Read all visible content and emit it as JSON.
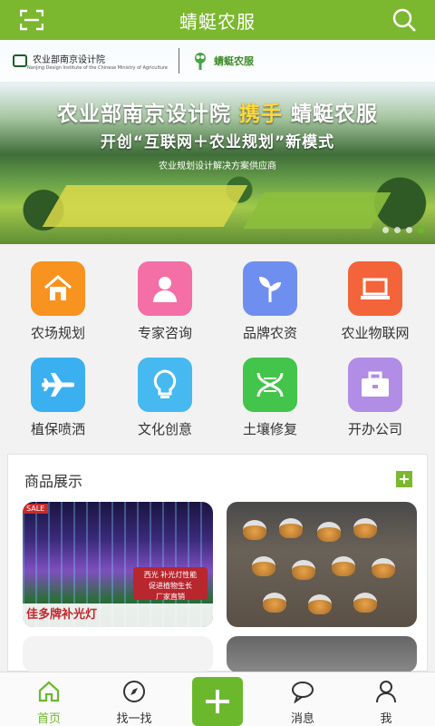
{
  "header": {
    "title": "蜻蜓农服",
    "scan_icon": "scan-icon",
    "search_icon": "search-icon"
  },
  "banner": {
    "org_name": "农业部南京设计院",
    "org_sub": "Nanjing Design Institute of the Chinese Ministry of Agriculture",
    "brand": "蜻蜓农服",
    "headline_part1": "农业部南京设计院",
    "headline_highlight": "携手",
    "headline_part2": "蜻蜓农服",
    "subheadline": "开创“互联网＋农业规划”新模式",
    "tagline": "农业规划设计解决方案供应商",
    "slides_total": 4,
    "active_slide": 4
  },
  "categories": [
    {
      "label": "农场规划",
      "icon": "house-icon",
      "color": "#f7931e"
    },
    {
      "label": "专家咨询",
      "icon": "person-icon",
      "color": "#f36fa6"
    },
    {
      "label": "品牌农资",
      "icon": "sprout-icon",
      "color": "#6f8ff0"
    },
    {
      "label": "农业物联网",
      "icon": "laptop-icon",
      "color": "#f4643a"
    },
    {
      "label": "植保喷洒",
      "icon": "airplane-icon",
      "color": "#3ab0f0"
    },
    {
      "label": "文化创意",
      "icon": "lightbulb-icon",
      "color": "#46b9f0"
    },
    {
      "label": "土壤修复",
      "icon": "dna-icon",
      "color": "#43c44a"
    },
    {
      "label": "开办公司",
      "icon": "briefcase-icon",
      "color": "#b18de6"
    }
  ],
  "goods": {
    "title": "商品展示",
    "more_icon": "plus-icon",
    "products": [
      {
        "caption": "佳多牌补光灯",
        "sale_tag": "SALE",
        "promo_line1": "促进植物生长",
        "promo_line2": "厂家直销",
        "promo_top": "西光 补光灯性能"
      },
      {
        "caption": ""
      }
    ]
  },
  "tabbar": {
    "items": [
      {
        "label": "首页",
        "icon": "home-icon",
        "active": true
      },
      {
        "label": "找一找",
        "icon": "compass-icon",
        "active": false
      },
      {
        "label": "消息",
        "icon": "message-icon",
        "active": false
      },
      {
        "label": "我",
        "icon": "user-icon",
        "active": false
      }
    ],
    "center_icon": "add-icon"
  },
  "colors": {
    "brand_green": "#7cb82f",
    "active_green": "#6cb82c"
  }
}
